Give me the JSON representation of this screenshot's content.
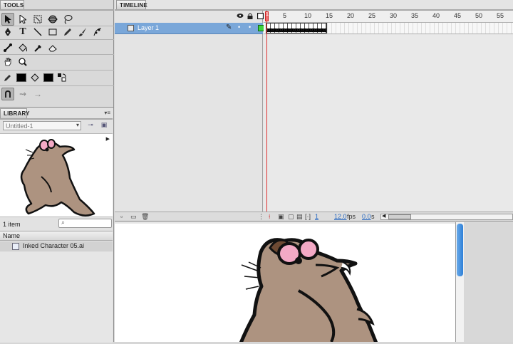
{
  "tools": {
    "title": "TOOLS",
    "icons": [
      "selection-arrow-icon",
      "subselection-icon",
      "free-transform-icon",
      "3d-rotation-icon",
      "lasso-icon",
      "pen-icon",
      "text-icon",
      "line-icon",
      "rectangle-icon",
      "pencil-icon",
      "brush-icon",
      "deco-icon",
      "bone-icon",
      "paint-bucket-icon",
      "eyedropper-icon",
      "eraser-icon",
      "hand-icon",
      "zoom-icon",
      "stroke-color-icon",
      "fill-color-icon",
      "swap-colors-icon",
      "snap-icon",
      "smooth-icon",
      "straighten-icon"
    ],
    "text_glyph": "T"
  },
  "library": {
    "title": "LIBRARY",
    "document": "Untitled-1",
    "item_count": "1 item",
    "search_placeholder": "",
    "column_name": "Name",
    "items": [
      {
        "name": "Inked Character 05.ai"
      }
    ]
  },
  "timeline": {
    "title": "TIMELINE",
    "layer_name": "Layer 1",
    "ruler": [
      "5",
      "10",
      "15",
      "20",
      "25",
      "30",
      "35",
      "40",
      "45",
      "50",
      "55"
    ],
    "playhead_frame": "1",
    "current_frame": "1",
    "fps": "12.0",
    "fps_unit": "fps",
    "time": "0.0",
    "time_unit": "s"
  },
  "colors": {
    "character_body": "#ad9380",
    "character_outline": "#111111",
    "eye_pink": "#f3a9c5",
    "accent_blue": "#2d7fd8",
    "layer_selected": "#7aa7d9"
  }
}
